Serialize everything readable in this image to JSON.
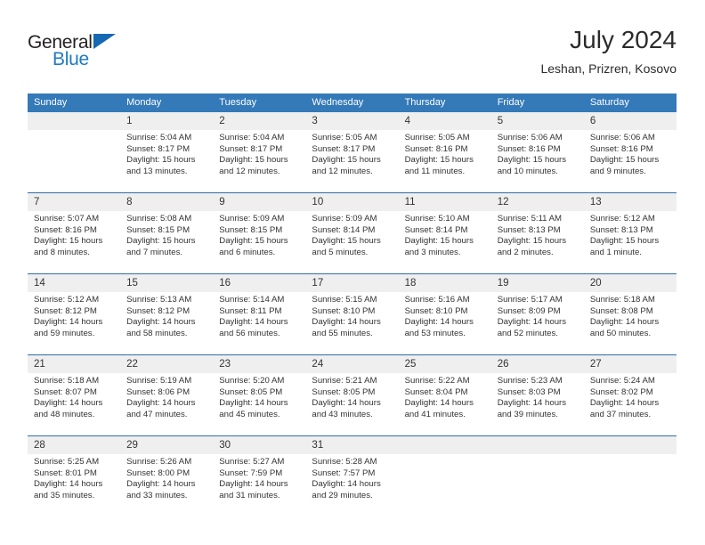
{
  "brand": {
    "name_part1": "General",
    "name_part2": "Blue",
    "triangle_icon": "triangle-icon",
    "accent_color": "#1d7bc4"
  },
  "header": {
    "title": "July 2024",
    "subtitle": "Leshan, Prizren, Kosovo"
  },
  "theme": {
    "header_bg": "#3479b8",
    "row_divider": "#2f6fa8",
    "daynum_bg": "#efefef",
    "text": "#333333"
  },
  "calendar": {
    "weekdays": [
      "Sunday",
      "Monday",
      "Tuesday",
      "Wednesday",
      "Thursday",
      "Friday",
      "Saturday"
    ],
    "weeks": [
      [
        {
          "day": "",
          "sunrise": "",
          "sunset": "",
          "daylight_line1": "",
          "daylight_line2": ""
        },
        {
          "day": "1",
          "sunrise": "Sunrise: 5:04 AM",
          "sunset": "Sunset: 8:17 PM",
          "daylight_line1": "Daylight: 15 hours",
          "daylight_line2": "and 13 minutes."
        },
        {
          "day": "2",
          "sunrise": "Sunrise: 5:04 AM",
          "sunset": "Sunset: 8:17 PM",
          "daylight_line1": "Daylight: 15 hours",
          "daylight_line2": "and 12 minutes."
        },
        {
          "day": "3",
          "sunrise": "Sunrise: 5:05 AM",
          "sunset": "Sunset: 8:17 PM",
          "daylight_line1": "Daylight: 15 hours",
          "daylight_line2": "and 12 minutes."
        },
        {
          "day": "4",
          "sunrise": "Sunrise: 5:05 AM",
          "sunset": "Sunset: 8:16 PM",
          "daylight_line1": "Daylight: 15 hours",
          "daylight_line2": "and 11 minutes."
        },
        {
          "day": "5",
          "sunrise": "Sunrise: 5:06 AM",
          "sunset": "Sunset: 8:16 PM",
          "daylight_line1": "Daylight: 15 hours",
          "daylight_line2": "and 10 minutes."
        },
        {
          "day": "6",
          "sunrise": "Sunrise: 5:06 AM",
          "sunset": "Sunset: 8:16 PM",
          "daylight_line1": "Daylight: 15 hours",
          "daylight_line2": "and 9 minutes."
        }
      ],
      [
        {
          "day": "7",
          "sunrise": "Sunrise: 5:07 AM",
          "sunset": "Sunset: 8:16 PM",
          "daylight_line1": "Daylight: 15 hours",
          "daylight_line2": "and 8 minutes."
        },
        {
          "day": "8",
          "sunrise": "Sunrise: 5:08 AM",
          "sunset": "Sunset: 8:15 PM",
          "daylight_line1": "Daylight: 15 hours",
          "daylight_line2": "and 7 minutes."
        },
        {
          "day": "9",
          "sunrise": "Sunrise: 5:09 AM",
          "sunset": "Sunset: 8:15 PM",
          "daylight_line1": "Daylight: 15 hours",
          "daylight_line2": "and 6 minutes."
        },
        {
          "day": "10",
          "sunrise": "Sunrise: 5:09 AM",
          "sunset": "Sunset: 8:14 PM",
          "daylight_line1": "Daylight: 15 hours",
          "daylight_line2": "and 5 minutes."
        },
        {
          "day": "11",
          "sunrise": "Sunrise: 5:10 AM",
          "sunset": "Sunset: 8:14 PM",
          "daylight_line1": "Daylight: 15 hours",
          "daylight_line2": "and 3 minutes."
        },
        {
          "day": "12",
          "sunrise": "Sunrise: 5:11 AM",
          "sunset": "Sunset: 8:13 PM",
          "daylight_line1": "Daylight: 15 hours",
          "daylight_line2": "and 2 minutes."
        },
        {
          "day": "13",
          "sunrise": "Sunrise: 5:12 AM",
          "sunset": "Sunset: 8:13 PM",
          "daylight_line1": "Daylight: 15 hours",
          "daylight_line2": "and 1 minute."
        }
      ],
      [
        {
          "day": "14",
          "sunrise": "Sunrise: 5:12 AM",
          "sunset": "Sunset: 8:12 PM",
          "daylight_line1": "Daylight: 14 hours",
          "daylight_line2": "and 59 minutes."
        },
        {
          "day": "15",
          "sunrise": "Sunrise: 5:13 AM",
          "sunset": "Sunset: 8:12 PM",
          "daylight_line1": "Daylight: 14 hours",
          "daylight_line2": "and 58 minutes."
        },
        {
          "day": "16",
          "sunrise": "Sunrise: 5:14 AM",
          "sunset": "Sunset: 8:11 PM",
          "daylight_line1": "Daylight: 14 hours",
          "daylight_line2": "and 56 minutes."
        },
        {
          "day": "17",
          "sunrise": "Sunrise: 5:15 AM",
          "sunset": "Sunset: 8:10 PM",
          "daylight_line1": "Daylight: 14 hours",
          "daylight_line2": "and 55 minutes."
        },
        {
          "day": "18",
          "sunrise": "Sunrise: 5:16 AM",
          "sunset": "Sunset: 8:10 PM",
          "daylight_line1": "Daylight: 14 hours",
          "daylight_line2": "and 53 minutes."
        },
        {
          "day": "19",
          "sunrise": "Sunrise: 5:17 AM",
          "sunset": "Sunset: 8:09 PM",
          "daylight_line1": "Daylight: 14 hours",
          "daylight_line2": "and 52 minutes."
        },
        {
          "day": "20",
          "sunrise": "Sunrise: 5:18 AM",
          "sunset": "Sunset: 8:08 PM",
          "daylight_line1": "Daylight: 14 hours",
          "daylight_line2": "and 50 minutes."
        }
      ],
      [
        {
          "day": "21",
          "sunrise": "Sunrise: 5:18 AM",
          "sunset": "Sunset: 8:07 PM",
          "daylight_line1": "Daylight: 14 hours",
          "daylight_line2": "and 48 minutes."
        },
        {
          "day": "22",
          "sunrise": "Sunrise: 5:19 AM",
          "sunset": "Sunset: 8:06 PM",
          "daylight_line1": "Daylight: 14 hours",
          "daylight_line2": "and 47 minutes."
        },
        {
          "day": "23",
          "sunrise": "Sunrise: 5:20 AM",
          "sunset": "Sunset: 8:05 PM",
          "daylight_line1": "Daylight: 14 hours",
          "daylight_line2": "and 45 minutes."
        },
        {
          "day": "24",
          "sunrise": "Sunrise: 5:21 AM",
          "sunset": "Sunset: 8:05 PM",
          "daylight_line1": "Daylight: 14 hours",
          "daylight_line2": "and 43 minutes."
        },
        {
          "day": "25",
          "sunrise": "Sunrise: 5:22 AM",
          "sunset": "Sunset: 8:04 PM",
          "daylight_line1": "Daylight: 14 hours",
          "daylight_line2": "and 41 minutes."
        },
        {
          "day": "26",
          "sunrise": "Sunrise: 5:23 AM",
          "sunset": "Sunset: 8:03 PM",
          "daylight_line1": "Daylight: 14 hours",
          "daylight_line2": "and 39 minutes."
        },
        {
          "day": "27",
          "sunrise": "Sunrise: 5:24 AM",
          "sunset": "Sunset: 8:02 PM",
          "daylight_line1": "Daylight: 14 hours",
          "daylight_line2": "and 37 minutes."
        }
      ],
      [
        {
          "day": "28",
          "sunrise": "Sunrise: 5:25 AM",
          "sunset": "Sunset: 8:01 PM",
          "daylight_line1": "Daylight: 14 hours",
          "daylight_line2": "and 35 minutes."
        },
        {
          "day": "29",
          "sunrise": "Sunrise: 5:26 AM",
          "sunset": "Sunset: 8:00 PM",
          "daylight_line1": "Daylight: 14 hours",
          "daylight_line2": "and 33 minutes."
        },
        {
          "day": "30",
          "sunrise": "Sunrise: 5:27 AM",
          "sunset": "Sunset: 7:59 PM",
          "daylight_line1": "Daylight: 14 hours",
          "daylight_line2": "and 31 minutes."
        },
        {
          "day": "31",
          "sunrise": "Sunrise: 5:28 AM",
          "sunset": "Sunset: 7:57 PM",
          "daylight_line1": "Daylight: 14 hours",
          "daylight_line2": "and 29 minutes."
        },
        {
          "day": "",
          "sunrise": "",
          "sunset": "",
          "daylight_line1": "",
          "daylight_line2": ""
        },
        {
          "day": "",
          "sunrise": "",
          "sunset": "",
          "daylight_line1": "",
          "daylight_line2": ""
        },
        {
          "day": "",
          "sunrise": "",
          "sunset": "",
          "daylight_line1": "",
          "daylight_line2": ""
        }
      ]
    ]
  }
}
